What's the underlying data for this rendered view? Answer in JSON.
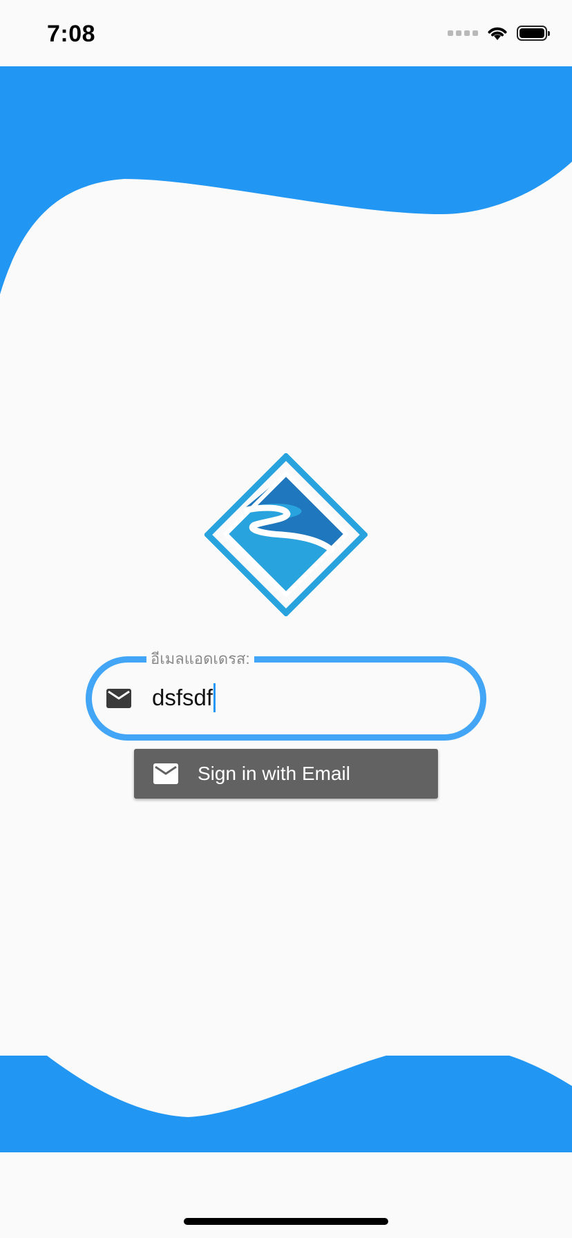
{
  "status_bar": {
    "time": "7:08"
  },
  "colors": {
    "wave": "#2196f3",
    "field_border": "#42a5f5",
    "button_bg": "#626262",
    "logo_dark": "#1f77bd",
    "logo_light": "#29a3dd"
  },
  "login": {
    "email_label": "อีเมลแอดเดรส:",
    "email_value": "dsfsdf",
    "email_icon": "mail-icon",
    "signin_button_label": "Sign in with Email",
    "signin_button_icon": "mail-icon"
  }
}
